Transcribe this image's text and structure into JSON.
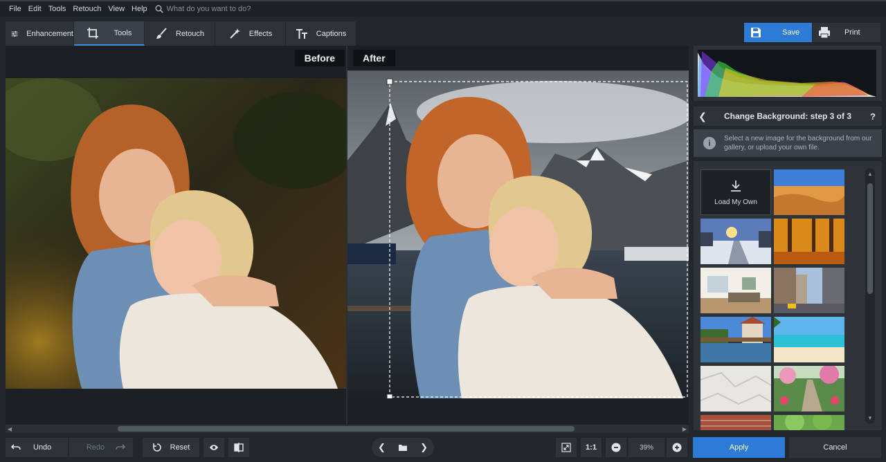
{
  "menu": {
    "items": [
      "File",
      "Edit",
      "Tools",
      "Retouch",
      "View",
      "Help"
    ],
    "search_placeholder": "What do you want to do?"
  },
  "tabs": [
    {
      "label": "Enhancement",
      "icon": "sliders-icon"
    },
    {
      "label": "Tools",
      "icon": "crop-icon",
      "active": true
    },
    {
      "label": "Retouch",
      "icon": "brush-icon"
    },
    {
      "label": "Effects",
      "icon": "magic-wand-icon"
    },
    {
      "label": "Captions",
      "icon": "text-icon"
    }
  ],
  "actions": {
    "save": "Save",
    "print": "Print"
  },
  "workspace": {
    "before_label": "Before",
    "after_label": "After"
  },
  "panel": {
    "step_title": "Change Background: step 3 of 3",
    "help": "?",
    "info_text": "Select a new image for the background from our gallery, or upload your own file.",
    "load_own": "Load My Own",
    "gallery": [
      "desert",
      "snowy-road-sunset",
      "autumn-forest",
      "living-room",
      "city-street",
      "village-canal",
      "tropical-beach",
      "crumpled-paper",
      "garden-path",
      "brick-wall",
      "green-field"
    ]
  },
  "bottom": {
    "undo": "Undo",
    "redo": "Redo",
    "reset": "Reset",
    "one_to_one": "1:1",
    "zoom": "39%",
    "apply": "Apply",
    "cancel": "Cancel"
  },
  "colors": {
    "accent": "#2d7bd6",
    "panel": "#2d3339",
    "background": "#22272c"
  }
}
